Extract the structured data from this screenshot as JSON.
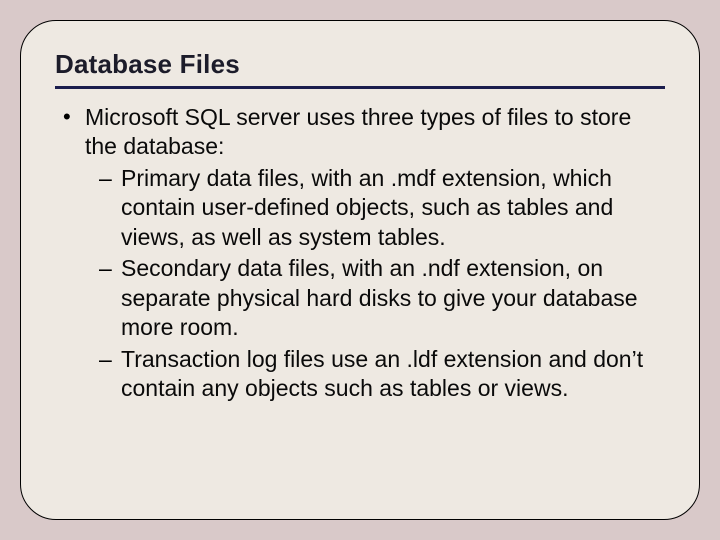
{
  "slide": {
    "title": "Database Files",
    "bullet": {
      "intro": "Microsoft SQL server uses three types of files to store the database:",
      "subitems": [
        "Primary data files, with an .mdf extension, which contain user-defined objects, such as tables and views, as well as system tables.",
        "Secondary data files, with an .ndf extension, on separate physical hard disks to give your database more room.",
        "Transaction log files use an .ldf extension and don’t contain any objects such as tables or views."
      ]
    }
  }
}
